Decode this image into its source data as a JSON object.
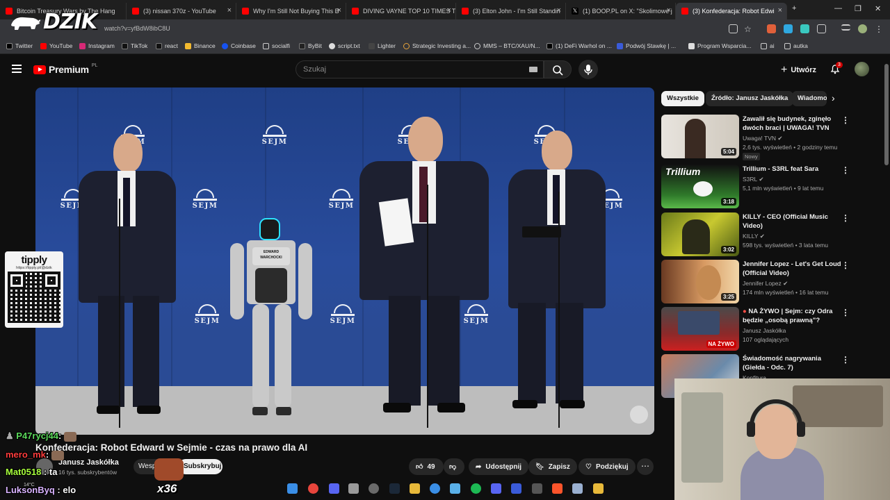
{
  "browser": {
    "tabs": [
      {
        "title": "Bitcoin Treasury Wars by The Hang",
        "icon": "youtube"
      },
      {
        "title": "(3) nissan 370z - YouTube",
        "icon": "youtube"
      },
      {
        "title": "Why I'm Still Not Buying This B",
        "icon": "youtube"
      },
      {
        "title": "DIVING VAYNE TOP 10 TIMES T",
        "icon": "youtube"
      },
      {
        "title": "(3) Elton John - I'm Still Standin",
        "icon": "youtube"
      },
      {
        "title": "(1) BOOP.PL on X: \"Skolimowe j",
        "icon": "x"
      },
      {
        "title": "(3) Konfederacja: Robot Edwi",
        "icon": "youtube"
      }
    ],
    "url": "watch?v=yfBdW8ibC8U",
    "bookmarks": [
      "Twitter",
      "YouTube",
      "Instagram",
      "TikTok",
      "react",
      "Binance",
      "Coinbase",
      "socialfi",
      "ByBit",
      "script.txt",
      "Lighter",
      "Strategic Investing a...",
      "MMS – BTC/XAU/N...",
      "(1) DeFi Warhol on ...",
      "Podwój Stawkę | ...",
      "Program Wsparcia...",
      "ai",
      "autka"
    ]
  },
  "overlay": {
    "logo_text": "DZIK",
    "tipply_title": "tipply",
    "tipply_url": "https://tipply.pl/@dzik"
  },
  "youtube": {
    "brand": "Premium",
    "brand_region": "PL",
    "search_placeholder": "Szukaj",
    "create_label": "Utwórz",
    "notifications": "3",
    "video": {
      "title": "Konfederacja: Robot Edward w Sejmie - czas na prawo dla AI",
      "channel": "Janusz Jaskółka",
      "subscribers": "16 tys. subskrybentów",
      "support_label": "Wesprzyj",
      "subscribe_label": "Subskrybuj",
      "likes": "49",
      "share_label": "Udostępnij",
      "save_label": "Zapisz",
      "thanks_label": "Podziękuj",
      "scene_text": {
        "sejm": "SEJM",
        "robot_sign": "EDWARD WARCHOCKI"
      }
    },
    "chips": [
      "Wszystkie",
      "Źródło: Janusz Jaskółka",
      "Wiadomości"
    ],
    "recommendations": [
      {
        "title": "Zawalił się budynek, zginęło dwóch braci | UWAGA! TVN",
        "channel": "Uwaga! TVN",
        "meta": "2,6 tys. wyświetleń • 2 godziny temu",
        "badge": "Nowy",
        "duration": "5:04"
      },
      {
        "title": "Trillium - S3RL feat Sara",
        "channel": "S3RL",
        "meta": "5,1 mln wyświetleń • 9 lat temu",
        "duration": "3:18"
      },
      {
        "title": "KILLY - CEO (Official Music Video)",
        "channel": "KILLY",
        "meta": "598 tys. wyświetleń • 3 lata temu",
        "duration": "3:02"
      },
      {
        "title": "Jennifer Lopez - Let's Get Loud (Official Video)",
        "channel": "Jennifer Lopez",
        "meta": "174 mln wyświetleń • 16 lat temu",
        "duration": "3:25"
      },
      {
        "title": "NA ŻYWO | Sejm: czy Odra będzie „osobą prawną\"?",
        "channel": "Janusz Jaskółka",
        "meta": "107 oglądających",
        "duration": "NA ŻYWO"
      },
      {
        "title": "Świadomość nagrywania (Giełda - Odc. 7)",
        "channel": "Konfitura",
        "meta": "",
        "duration": ""
      }
    ]
  },
  "chat": [
    {
      "user": "P47rycj44",
      "message": ""
    },
    {
      "user": "mero_mk",
      "message": ""
    },
    {
      "user": "Mat0518",
      "message": "ta"
    },
    {
      "user": "LuksonByq",
      "message": "elo"
    }
  ],
  "tip_count": "x36",
  "weather": "14°C",
  "colors": {
    "accent": "#ff0000",
    "background": "#0f0f0f",
    "surface": "#272727",
    "text": "#f1f1f1",
    "muted": "#aaaaaa"
  }
}
